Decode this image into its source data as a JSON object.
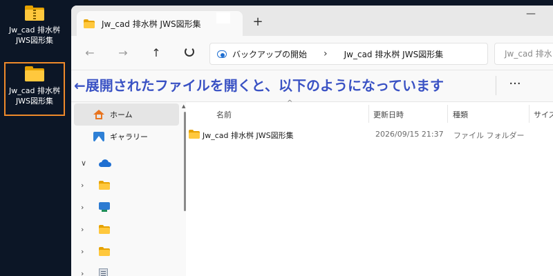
{
  "desktop": {
    "icons": [
      {
        "label": "Jw_cad 排水桝\nJWS図形集",
        "type": "zip-folder"
      },
      {
        "label": "Jw_cad 排水桝\nJWS図形集",
        "type": "folder",
        "selected": true
      }
    ],
    "selection_color": "#f08a2a"
  },
  "window": {
    "tab": {
      "title": "Jw_cad 排水桝 JWS図形集"
    },
    "new_tab_label": "+",
    "minimize_label": "—",
    "nav": {
      "back": "←",
      "forward": "→",
      "up": "↑"
    },
    "address": {
      "crumbs": [
        "バックアップの開始",
        "Jw_cad 排水桝 JWS図形集"
      ],
      "separator": "›"
    },
    "search": {
      "placeholder": "Jw_cad 排水"
    },
    "annotation": {
      "text": "←展開されたファイルを開くと、以下のようになっています",
      "color": "#3a52c4"
    },
    "more_label": "···"
  },
  "sidebar": {
    "items": [
      {
        "label": "ホーム",
        "icon": "home-icon"
      },
      {
        "label": "ギャラリー",
        "icon": "gallery-icon"
      },
      {
        "label": "",
        "icon": "onedrive-cloud-icon",
        "expanded": true
      },
      {
        "label": "",
        "icon": "folder-icon"
      },
      {
        "label": "",
        "icon": "network-icon"
      },
      {
        "label": "",
        "icon": "folder-icon"
      },
      {
        "label": "",
        "icon": "folder-icon"
      },
      {
        "label": "",
        "icon": "document-icon"
      }
    ],
    "chevron_expanded": "∨",
    "chevron_collapsed": "›"
  },
  "content": {
    "columns": [
      "名前",
      "更新日時",
      "種類",
      "サイズ"
    ],
    "sort_indicator": "^",
    "rows": [
      {
        "name": "Jw_cad 排水桝 JWS図形集",
        "modified": "2026/09/15 21:37",
        "type": "ファイル フォルダー",
        "size": ""
      }
    ]
  }
}
